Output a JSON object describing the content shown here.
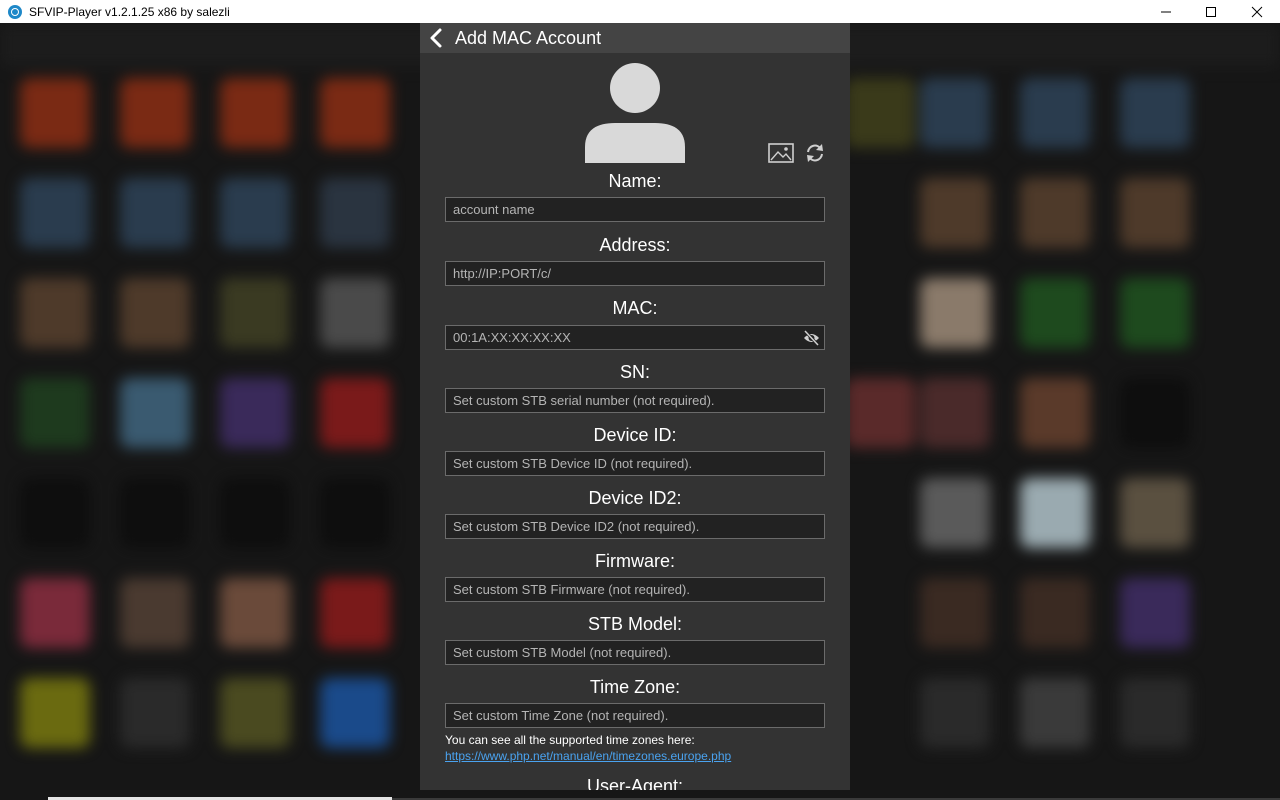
{
  "window": {
    "title": "SFVIP-Player v1.2.1.25 x86 by salezli",
    "minimize": "—",
    "maximize": "☐",
    "close": "✕"
  },
  "dialog": {
    "title": "Add MAC Account",
    "fields": {
      "name": {
        "label": "Name:",
        "placeholder": "account name"
      },
      "address": {
        "label": "Address:",
        "placeholder": "http://IP:PORT/c/"
      },
      "mac": {
        "label": "MAC:",
        "placeholder": "00:1A:XX:XX:XX:XX"
      },
      "sn": {
        "label": "SN:",
        "placeholder": "Set custom STB serial number (not required)."
      },
      "device_id": {
        "label": "Device ID:",
        "placeholder": "Set custom STB Device ID (not required)."
      },
      "device_id2": {
        "label": "Device ID2:",
        "placeholder": "Set custom STB Device ID2 (not required)."
      },
      "firmware": {
        "label": "Firmware:",
        "placeholder": "Set custom STB Firmware (not required)."
      },
      "stb_model": {
        "label": "STB Model:",
        "placeholder": "Set custom STB Model (not required)."
      },
      "time_zone": {
        "label": "Time Zone:",
        "placeholder": "Set custom Time Zone (not required)."
      },
      "user_agent": {
        "label": "User-Agent:"
      }
    },
    "tz_note": "You can see all the supported time zones here:",
    "tz_link": "https://www.php.net/manual/en/timezones.europe.php"
  },
  "icons": {
    "back": "chevron-left-icon",
    "avatar": "user-silhouette-icon",
    "image": "image-icon",
    "refresh": "refresh-icon",
    "eye": "eye-slash-icon"
  },
  "colors": {
    "dialog_bg": "#333333",
    "header_bg": "#444444",
    "field_bg": "#222222",
    "link": "#4aa3f0"
  }
}
